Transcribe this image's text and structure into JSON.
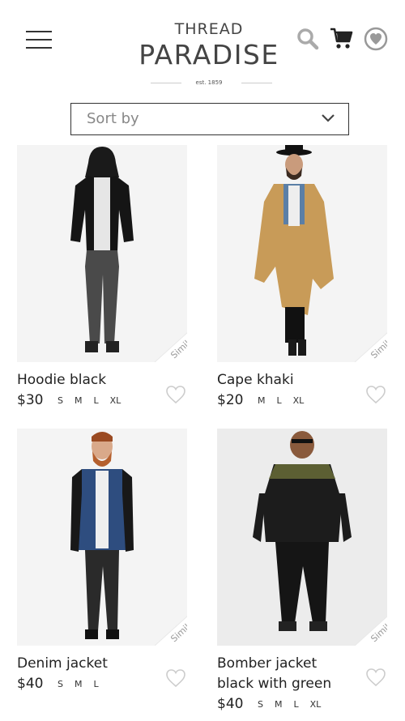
{
  "header": {
    "menu_icon": "hamburger-menu-icon",
    "logo_top": "THREAD",
    "logo_main": "PARADISE",
    "logo_est": "est. 1859",
    "icons": [
      "search-icon",
      "cart-icon",
      "favorites-heart-icon"
    ]
  },
  "sort": {
    "label": "Sort by",
    "icon": "chevron-down-icon"
  },
  "similar_label": "Similar",
  "products": [
    {
      "name": "Hoodie black",
      "price": "$30",
      "sizes": [
        "S",
        "M",
        "L",
        "XL"
      ]
    },
    {
      "name": "Cape khaki",
      "price": "$20",
      "sizes": [
        "M",
        "L",
        "XL"
      ]
    },
    {
      "name": "Denim jacket",
      "price": "$40",
      "sizes": [
        "S",
        "M",
        "L"
      ]
    },
    {
      "name": "Bomber jacket black with green",
      "price": "$40",
      "sizes": [
        "S",
        "M",
        "L",
        "XL"
      ]
    }
  ],
  "colors": {
    "text": "#222222",
    "icon_gray": "#aaaaaa",
    "border": "#333333"
  }
}
